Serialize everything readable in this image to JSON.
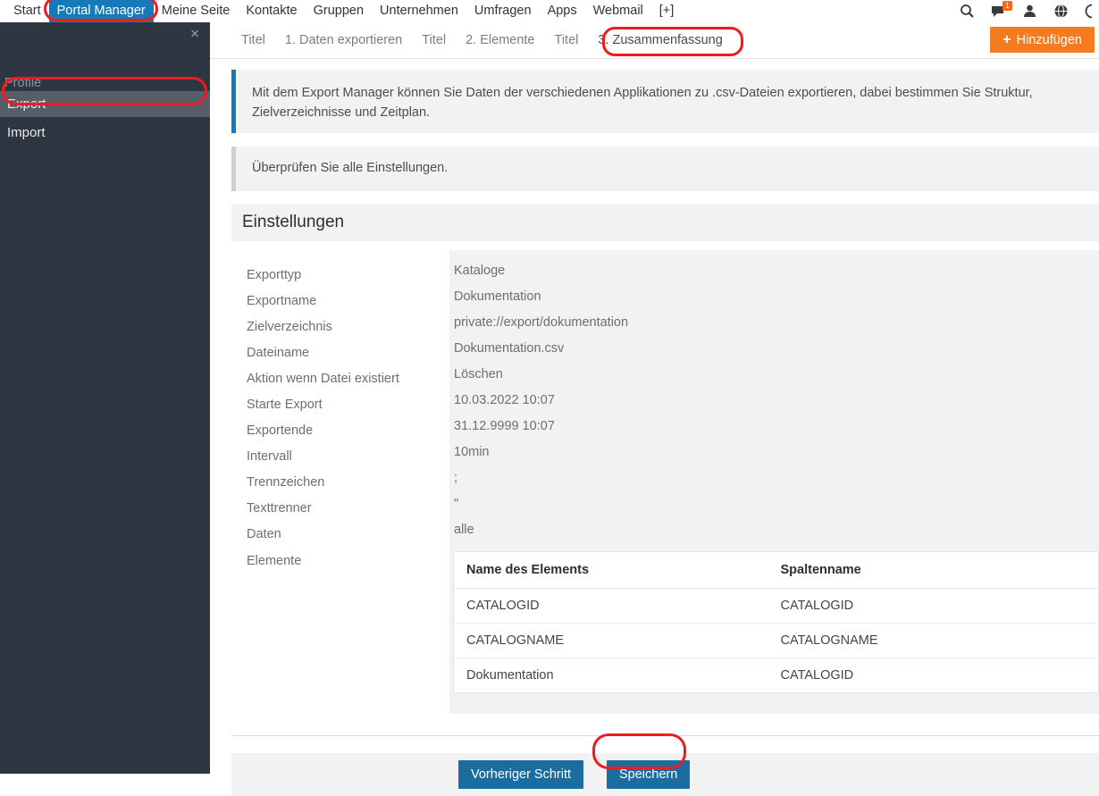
{
  "topnav": {
    "links": [
      {
        "label": "Start",
        "active": false
      },
      {
        "label": "Portal Manager",
        "active": true
      },
      {
        "label": "Meine Seite",
        "active": false
      },
      {
        "label": "Kontakte",
        "active": false
      },
      {
        "label": "Gruppen",
        "active": false
      },
      {
        "label": "Unternehmen",
        "active": false
      },
      {
        "label": "Umfragen",
        "active": false
      },
      {
        "label": "Apps",
        "active": false
      },
      {
        "label": "Webmail",
        "active": false
      },
      {
        "label": "[+]",
        "active": false
      }
    ],
    "icons": [
      {
        "name": "search-icon",
        "glyph": "⌕"
      },
      {
        "name": "messages-icon",
        "glyph": "▮",
        "badge": "1"
      },
      {
        "name": "user-icon",
        "glyph": "♟"
      },
      {
        "name": "globe-icon",
        "glyph": "●"
      },
      {
        "name": "help-icon",
        "glyph": "○"
      }
    ],
    "active_color": "#1779ba",
    "badge_color": "#f26a1b"
  },
  "sidebar": {
    "close_label": "×",
    "group_label": "Profile",
    "items": [
      {
        "label": "Export",
        "selected": true
      },
      {
        "label": "Import",
        "selected": false
      }
    ],
    "background": "#2e3642",
    "selected_background": "#565e6a"
  },
  "tabs": [
    {
      "label": "Titel",
      "current": false
    },
    {
      "label": "1. Daten exportieren",
      "current": false
    },
    {
      "label": "Titel",
      "current": false
    },
    {
      "label": "2. Elemente",
      "current": false
    },
    {
      "label": "Titel",
      "current": false
    },
    {
      "label": "3. Zusammenfassung",
      "current": true
    }
  ],
  "toolbar": {
    "add_label": "Hinzufügen",
    "add_icon": "+",
    "add_color": "#f47b20"
  },
  "messages": {
    "info": "Mit dem Export Manager können Sie Daten der verschiedenen Applikationen zu .csv-Dateien exportieren, dabei bestimmen Sie Struktur, Zielverzeichnisse und Zeitplan.",
    "hint": "Überprüfen Sie alle Einstellungen.",
    "info_accent": "#1779ba",
    "hint_accent": "#cfcfcf"
  },
  "settings": {
    "title": "Einstellungen",
    "fields": [
      {
        "label": "Exporttyp",
        "value": "Kataloge"
      },
      {
        "label": "Exportname",
        "value": "Dokumentation"
      },
      {
        "label": "Zielverzeichnis",
        "value": "private://export/dokumentation"
      },
      {
        "label": "Dateiname",
        "value": "Dokumentation.csv"
      },
      {
        "label": "Aktion wenn Datei existiert",
        "value": "Löschen"
      },
      {
        "label": "Starte Export",
        "value": "10.03.2022 10:07"
      },
      {
        "label": "Exportende",
        "value": "31.12.9999 10:07"
      },
      {
        "label": "Intervall",
        "value": "10min"
      },
      {
        "label": "Trennzeichen",
        "value": ";"
      },
      {
        "label": "Texttrenner",
        "value": "\""
      },
      {
        "label": "Daten",
        "value": "alle"
      },
      {
        "label": "Elemente",
        "value": ""
      }
    ]
  },
  "elements_table": {
    "columns": [
      "Name des Elements",
      "Spaltenname"
    ],
    "rows": [
      [
        "CATALOGID",
        "CATALOGID"
      ],
      [
        "CATALOGNAME",
        "CATALOGNAME"
      ],
      [
        "Dokumentation",
        "CATALOGID"
      ]
    ]
  },
  "footer": {
    "prev_label": "Vorheriger Schritt",
    "save_label": "Speichern",
    "button_color": "#1a6d9e"
  },
  "annotations": {
    "color": "#ee1c1c",
    "highlights": [
      "Portal Manager",
      "Export",
      "3. Zusammenfassung",
      "Speichern"
    ]
  }
}
